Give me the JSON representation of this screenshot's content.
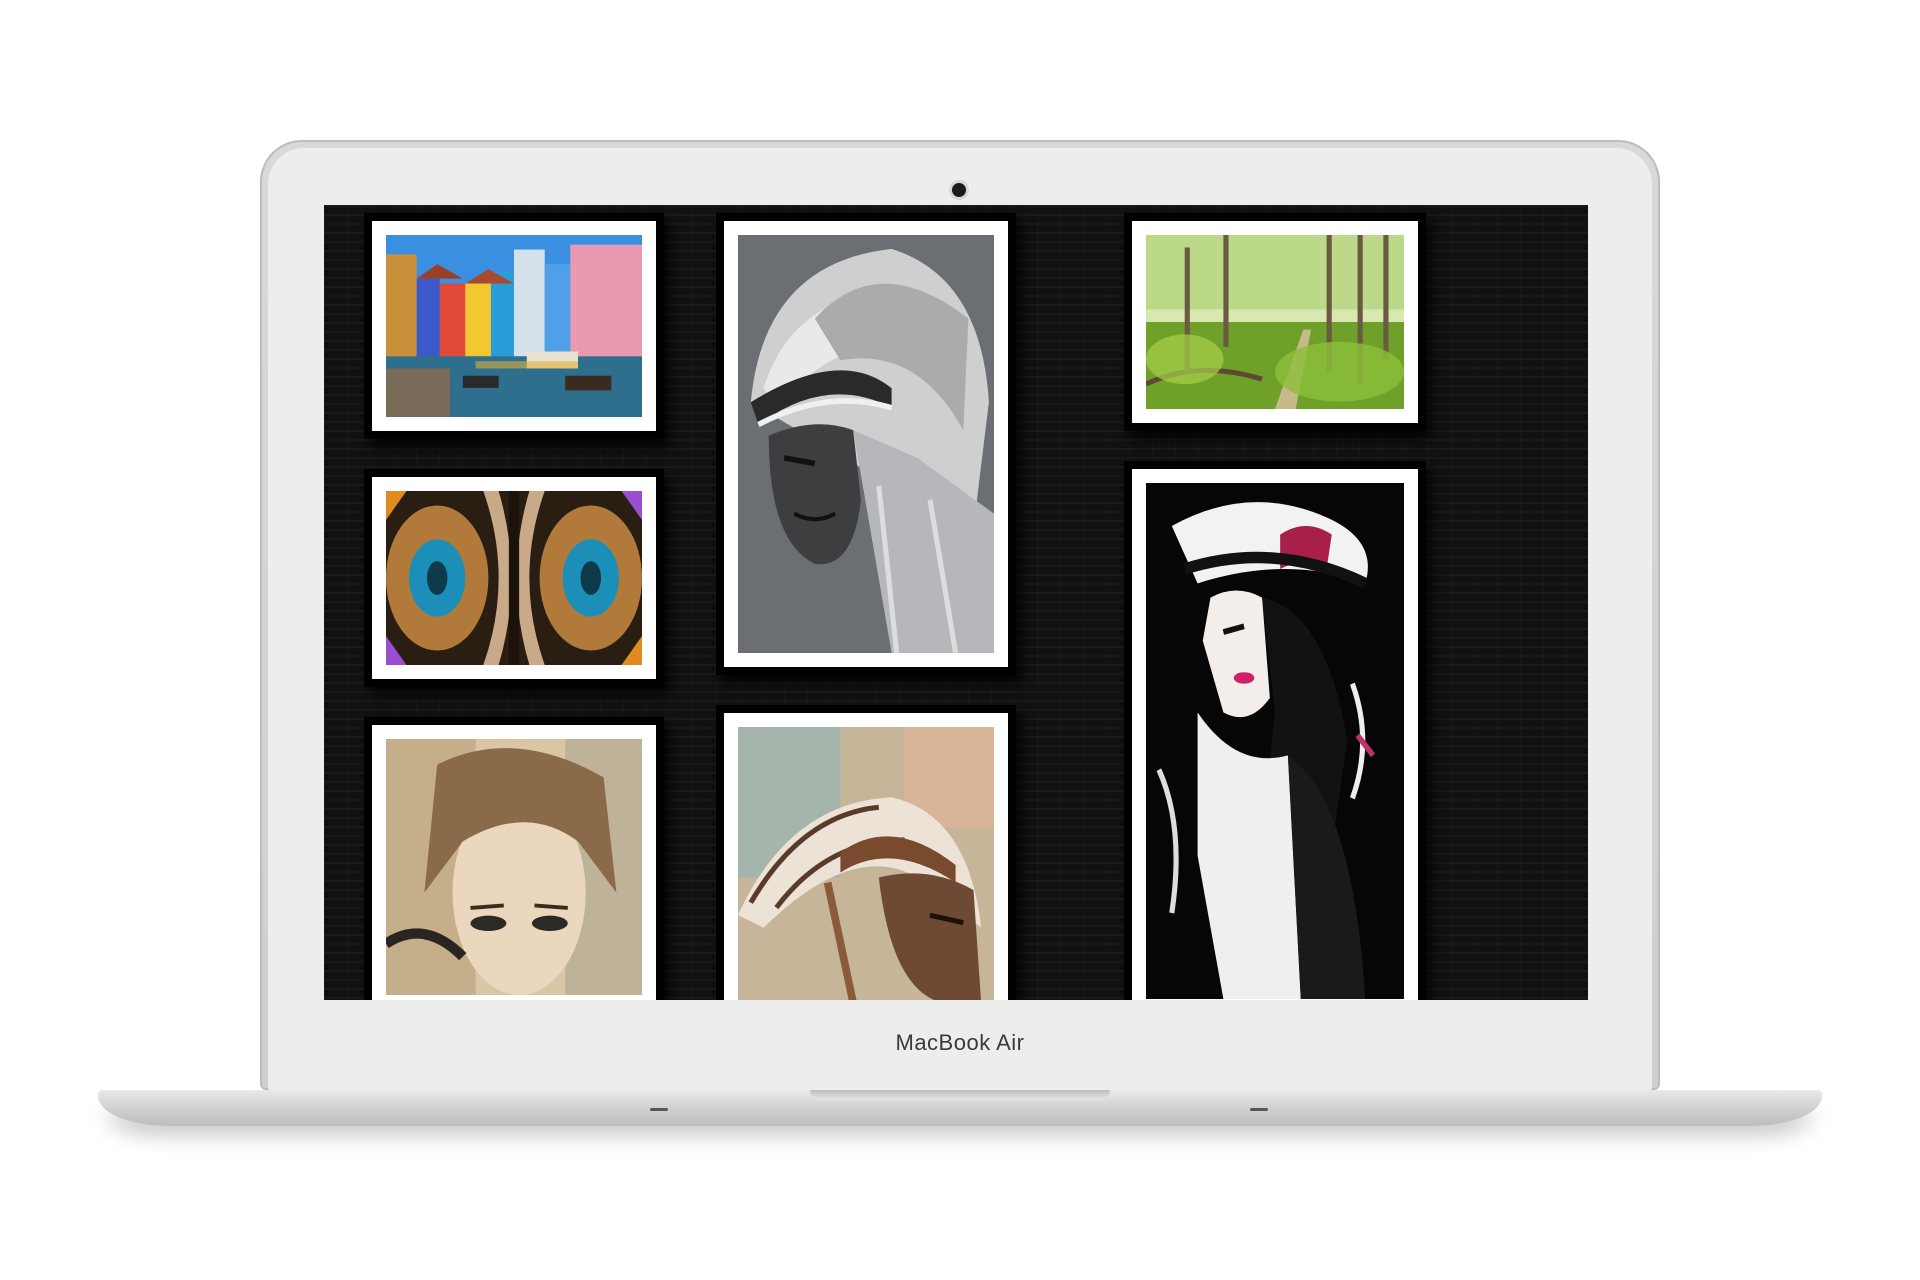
{
  "device": {
    "label": "MacBook Air"
  },
  "gallery": {
    "artworks": [
      {
        "subject": "colorful-canal-houses-artwork"
      },
      {
        "subject": "kaleidoscope-fractal-artwork"
      },
      {
        "subject": "woman-face-painting-artwork"
      },
      {
        "subject": "native-chief-sketch-bw-artwork"
      },
      {
        "subject": "native-chief-sketch-color-artwork"
      },
      {
        "subject": "green-forest-path-artwork"
      },
      {
        "subject": "woman-in-hat-ink-artwork"
      }
    ]
  },
  "colors": {
    "screen_background": "#111111",
    "mat": "#ffffff",
    "frame": "#000000",
    "laptop_silver": "#d9d9d9"
  }
}
